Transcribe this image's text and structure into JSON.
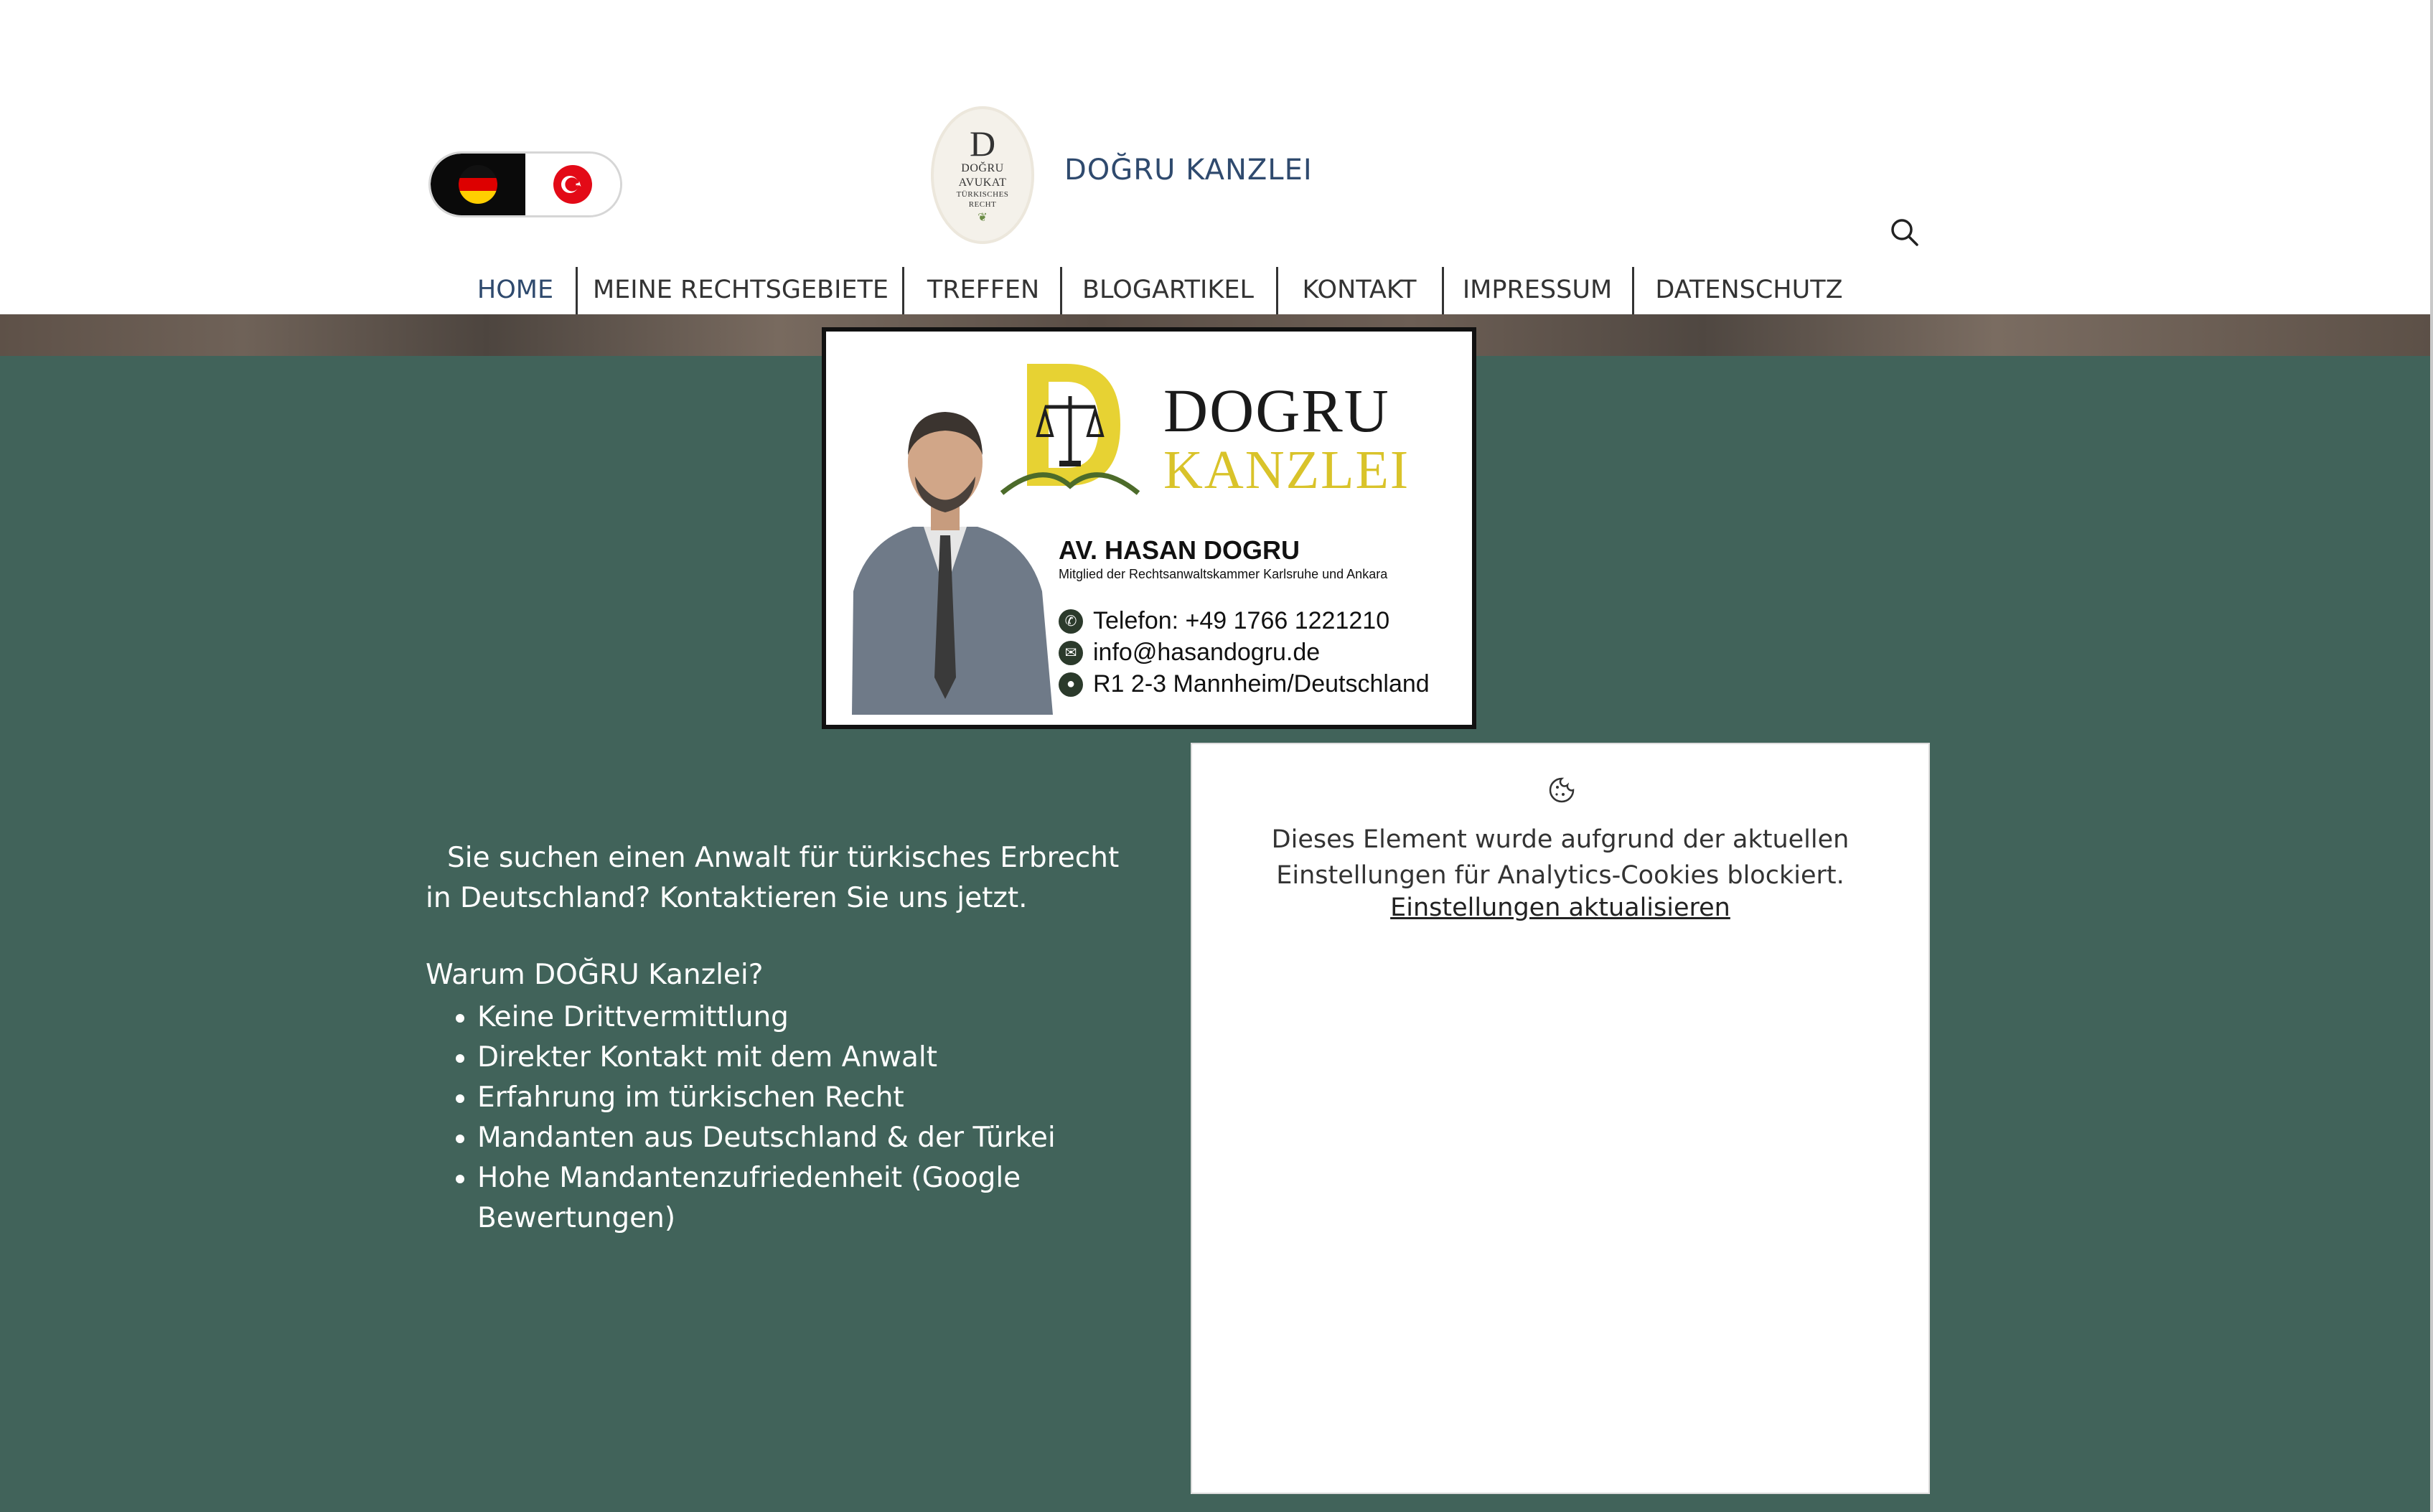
{
  "header": {
    "brand_title": "DOĞRU KANZLEI",
    "logo": {
      "letter": "D",
      "line1": "DOĞRU",
      "line2": "AVUKAT",
      "line3": "TÜRKISCHES",
      "line4": "RECHT"
    },
    "languages": [
      {
        "code": "de",
        "icon": "flag-germany-icon",
        "active": true
      },
      {
        "code": "tr",
        "icon": "flag-turkey-icon",
        "active": false
      }
    ],
    "search_icon": "search-icon"
  },
  "nav": {
    "items": [
      {
        "label": "HOME",
        "active": true
      },
      {
        "label": "MEINE RECHTSGEBIETE",
        "active": false
      },
      {
        "label": "TREFFEN",
        "active": false
      },
      {
        "label": "BLOGARTIKEL",
        "active": false
      },
      {
        "label": "KONTAKT",
        "active": false
      },
      {
        "label": "IMPRESSUM",
        "active": false
      },
      {
        "label": "DATENSCHUTZ",
        "active": false
      }
    ]
  },
  "card": {
    "brand_line1": "DOGRU",
    "brand_line2": "KANZLEI",
    "person": "AV. HASAN DOGRU",
    "subtitle": "Mitglied der Rechtsanwaltskammer Karlsruhe und Ankara",
    "phone": "Telefon: +49 1766 1221210",
    "email": "info@hasandogru.de",
    "address": "R1 2-3 Mannheim/Deutschland"
  },
  "intro": {
    "text": "Sie suchen einen Anwalt für türkisches Erbrecht in Deutschland? Kontaktieren Sie uns jetzt.",
    "why_heading": "Warum DOĞRU Kanzlei?",
    "bullets": [
      "Keine Drittvermittlung",
      "Direkter Kontakt mit dem Anwalt",
      "Erfahrung im türkischen Recht",
      "Mandanten aus Deutschland & der Türkei",
      "Hohe Mandantenzufriedenheit (Google Bewertungen)"
    ]
  },
  "blocked_embed": {
    "icon": "cookie-icon",
    "message_line1": "Dieses Element wurde aufgrund der aktuellen",
    "message_line2": "Einstellungen für Analytics-Cookies blockiert.",
    "link": "Einstellungen aktualisieren"
  },
  "colors": {
    "accent_blue": "#2f4a6e",
    "main_green": "#41635a",
    "card_gold": "#d9c32a",
    "text_white": "#ffffff"
  }
}
